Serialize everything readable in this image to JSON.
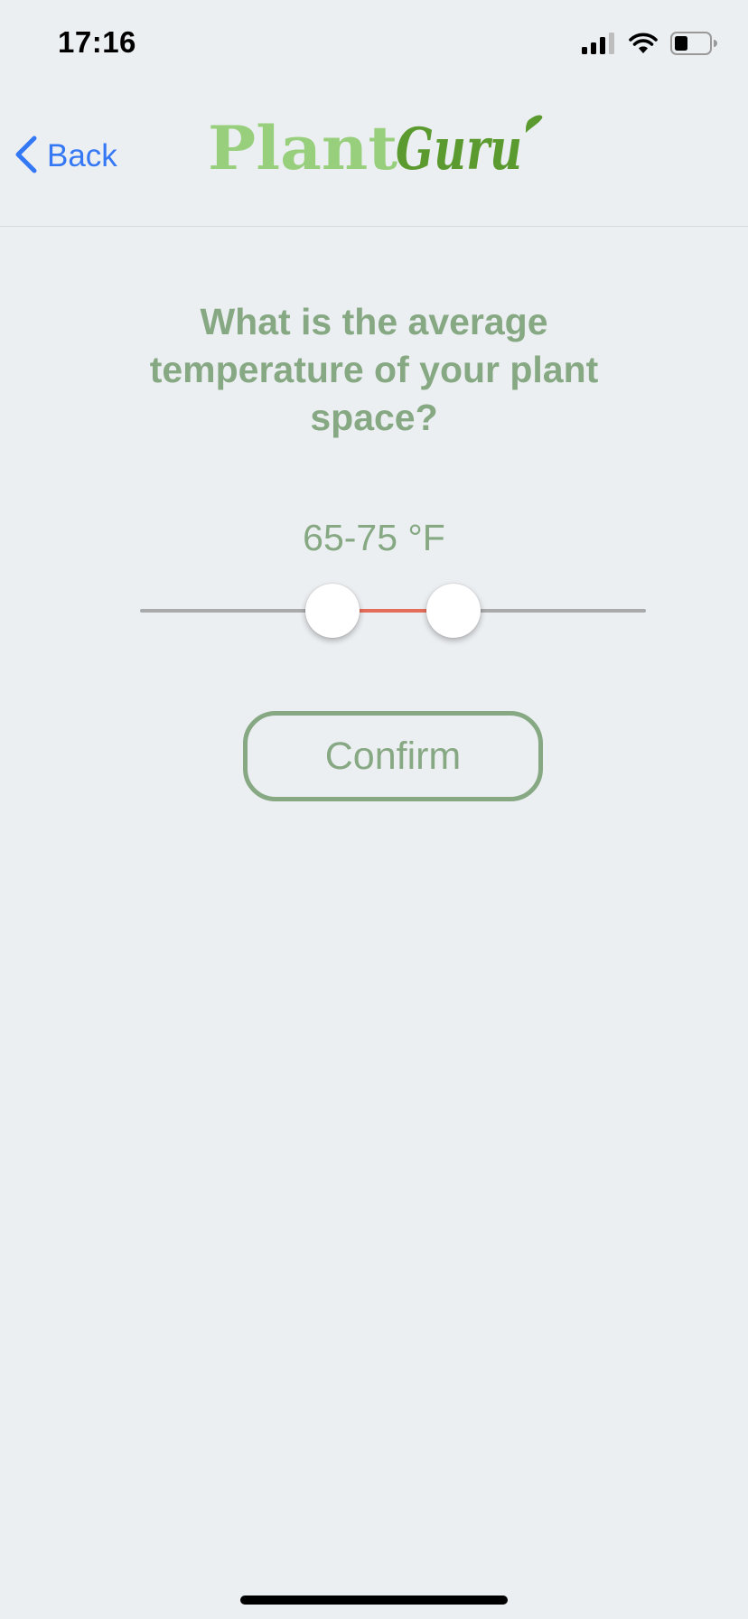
{
  "status_bar": {
    "time": "17:16",
    "icons": [
      "signal-icon",
      "wifi-icon",
      "battery-icon"
    ]
  },
  "nav": {
    "back_label": "Back",
    "logo": {
      "part1": "Plant",
      "part2": "Guru",
      "colors": {
        "part1": "#98CF7C",
        "part2": "#5A9A2E"
      }
    }
  },
  "question": {
    "text": "What is the average temperature of your plant space?"
  },
  "temperature_range": {
    "label": "65-75 °F",
    "min_value": 65,
    "max_value": 75,
    "lower_thumb_fraction": 0.38,
    "upper_thumb_fraction": 0.62
  },
  "confirm": {
    "label": "Confirm"
  },
  "colors": {
    "background": "#ECEFF2",
    "accent_green": "#86A883",
    "back_blue": "#3478F6",
    "slider_fill": "#E56E5A",
    "slider_track": "#A8AAAC"
  }
}
